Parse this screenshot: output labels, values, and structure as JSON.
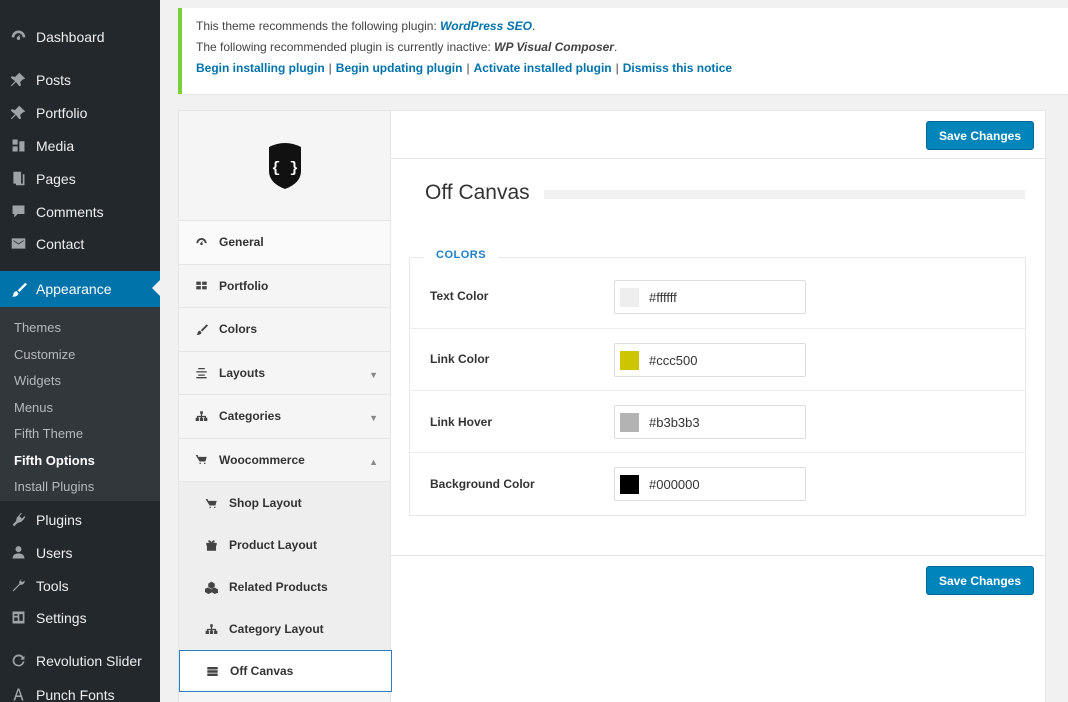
{
  "admin_menu": {
    "items_top": [
      {
        "label": "Dashboard",
        "icon": "dashboard-icon"
      },
      {
        "label": "Posts",
        "icon": "pin-icon"
      },
      {
        "label": "Portfolio",
        "icon": "pin-icon"
      },
      {
        "label": "Media",
        "icon": "media-icon"
      },
      {
        "label": "Pages",
        "icon": "pages-icon"
      },
      {
        "label": "Comments",
        "icon": "comment-icon"
      },
      {
        "label": "Contact",
        "icon": "mail-icon"
      }
    ],
    "current": {
      "label": "Appearance",
      "icon": "brush-icon"
    },
    "submenu": [
      "Themes",
      "Customize",
      "Widgets",
      "Menus",
      "Fifth Theme",
      "Fifth Options",
      "Install Plugins"
    ],
    "submenu_current": "Fifth Options",
    "items_bottom": [
      {
        "label": "Plugins",
        "icon": "plugin-icon"
      },
      {
        "label": "Users",
        "icon": "user-icon"
      },
      {
        "label": "Tools",
        "icon": "wrench-icon"
      },
      {
        "label": "Settings",
        "icon": "settings-icon"
      },
      {
        "label": "Revolution Slider",
        "icon": "refresh-icon"
      },
      {
        "label": "Punch Fonts",
        "icon": "font-icon"
      }
    ]
  },
  "notice": {
    "line1_prefix": "This theme recommends the following plugin: ",
    "line1_plugin": "WordPress SEO",
    "line1_suffix": ".",
    "line2_prefix": "The following recommended plugin is currently inactive: ",
    "line2_plugin": "WP Visual Composer",
    "line2_suffix": ".",
    "links": [
      "Begin installing plugin",
      "Begin updating plugin",
      "Activate installed plugin",
      "Dismiss this notice"
    ],
    "separator": "|"
  },
  "options_nav": {
    "items": [
      {
        "label": "General",
        "icon": "dashboard-icon"
      },
      {
        "label": "Portfolio",
        "icon": "grid-icon"
      },
      {
        "label": "Colors",
        "icon": "brush-icon"
      },
      {
        "label": "Layouts",
        "icon": "align-icon",
        "arrow": "▼"
      },
      {
        "label": "Categories",
        "icon": "sitemap-icon",
        "arrow": "▼"
      },
      {
        "label": "Woocommerce",
        "icon": "cart-icon",
        "arrow": "▲"
      }
    ],
    "subitems": [
      {
        "label": "Shop Layout",
        "icon": "cart-icon"
      },
      {
        "label": "Product Layout",
        "icon": "gift-icon"
      },
      {
        "label": "Related Products",
        "icon": "cubes-icon"
      },
      {
        "label": "Category Layout",
        "icon": "sitemap-icon"
      },
      {
        "label": "Off Canvas",
        "icon": "server-icon",
        "active": true
      }
    ]
  },
  "main": {
    "save_label": "Save Changes",
    "section_title": "Off Canvas",
    "group_legend": "COLORS",
    "colors": [
      {
        "label": "Text Color",
        "value": "#ffffff",
        "swatch": "#eeeeee"
      },
      {
        "label": "Link Color",
        "value": "#ccc500",
        "swatch": "#ccc500"
      },
      {
        "label": "Link Hover",
        "value": "#b3b3b3",
        "swatch": "#b3b3b3"
      },
      {
        "label": "Background Color",
        "value": "#000000",
        "swatch": "#000000"
      }
    ]
  },
  "theme": {
    "accent": "#0073aa",
    "notice_border": "#7ad03a",
    "button": "#0085ba",
    "sidebar_bg": "#23282d"
  }
}
